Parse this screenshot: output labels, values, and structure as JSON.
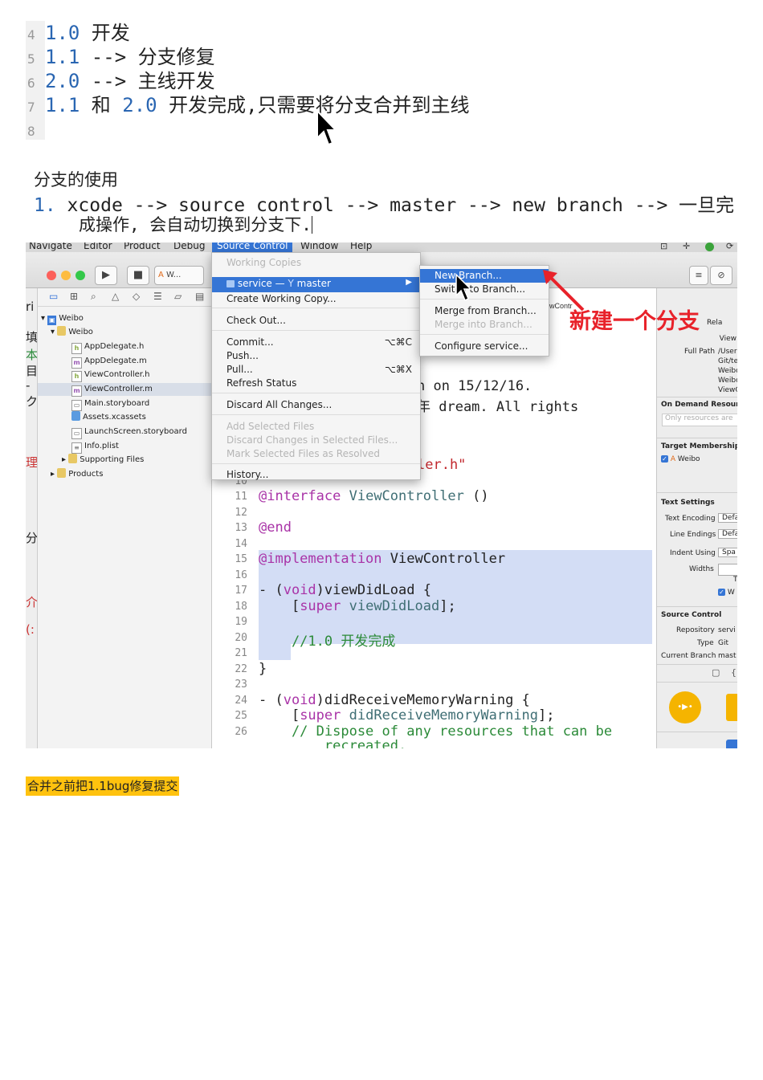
{
  "block1": {
    "lines": [
      {
        "ln": "4",
        "num": "1.0",
        "text": " 开发"
      },
      {
        "ln": "5",
        "num": "1.1",
        "text": " --> 分支修复"
      },
      {
        "ln": "6",
        "num": "2.0",
        "text": " --> 主线开发"
      },
      {
        "ln": "7",
        "num": "1.1",
        "text": " 和 ",
        "num2": "2.0",
        "text2": " 开发完成,只需要将分支合并到主线"
      },
      {
        "ln": "8",
        "num": "",
        "text": ""
      }
    ]
  },
  "block2": {
    "title": "分支的使用",
    "step_num": "1.",
    "step_text": " xcode --> source control --> master --> new branch --> 一旦完",
    "step_cont": "成操作, 会自动切换到分支下."
  },
  "screenshot": {
    "menubar": [
      "Navigate",
      "Editor",
      "Product",
      "Debug",
      "Source Control",
      "Window",
      "Help"
    ],
    "toolbar": {
      "scheme": "W..."
    },
    "left_strip": [
      "ri",
      "填",
      "本",
      "目",
      "-",
      "ク",
      "理",
      "分",
      "介",
      "(:"
    ],
    "navigator": {
      "items": [
        {
          "label": "Weibo",
          "indent": 0,
          "icon": "project"
        },
        {
          "label": "Weibo",
          "indent": 1,
          "icon": "folder"
        },
        {
          "label": "AppDelegate.h",
          "indent": 2,
          "icon": "h"
        },
        {
          "label": "AppDelegate.m",
          "indent": 2,
          "icon": "m"
        },
        {
          "label": "ViewController.h",
          "indent": 2,
          "icon": "h"
        },
        {
          "label": "ViewController.m",
          "indent": 2,
          "icon": "m"
        },
        {
          "label": "Main.storyboard",
          "indent": 2,
          "icon": "sb"
        },
        {
          "label": "Assets.xcassets",
          "indent": 2,
          "icon": "folder"
        },
        {
          "label": "LaunchScreen.storyboard",
          "indent": 2,
          "icon": "sb"
        },
        {
          "label": "Info.plist",
          "indent": 2,
          "icon": "plist"
        },
        {
          "label": "Supporting Files",
          "indent": 1,
          "icon": "folder"
        },
        {
          "label": "Products",
          "indent": 0,
          "icon": "folder"
        }
      ],
      "selected_index": 5
    },
    "editor": {
      "header_fragment": "wContr",
      "fragments": [
        {
          "text": "n on 15/12/16."
        },
        {
          "text": "年 dream. All rights"
        },
        {
          "text": "ler.h\""
        }
      ],
      "lines": [
        {
          "n": "10",
          "code": ""
        },
        {
          "n": "11",
          "code": "@interface ViewController ()"
        },
        {
          "n": "12",
          "code": ""
        },
        {
          "n": "13",
          "code": "@end"
        },
        {
          "n": "14",
          "code": ""
        },
        {
          "n": "15",
          "code": "@implementation ViewController"
        },
        {
          "n": "16",
          "code": ""
        },
        {
          "n": "17",
          "code": "- (void)viewDidLoad {"
        },
        {
          "n": "18",
          "code": "    [super viewDidLoad];"
        },
        {
          "n": "19",
          "code": ""
        },
        {
          "n": "20",
          "code": "    //1.0 开发完成"
        },
        {
          "n": "21",
          "code": ""
        },
        {
          "n": "22",
          "code": "}"
        },
        {
          "n": "23",
          "code": ""
        },
        {
          "n": "24",
          "code": "- (void)didReceiveMemoryWarning {"
        },
        {
          "n": "25",
          "code": "    [super didReceiveMemoryWarning];"
        },
        {
          "n": "26",
          "code": "    // Dispose of any resources that can be"
        },
        {
          "n": "",
          "code": "        recreated."
        }
      ]
    },
    "source_control_menu": {
      "working_copies": "Working Copies",
      "service": "service — ",
      "branch": "master",
      "create_working_copy": "Create Working Copy...",
      "check_out": "Check Out...",
      "commit": "Commit...",
      "commit_sc": "⌥⌘C",
      "push": "Push...",
      "pull": "Pull...",
      "pull_sc": "⌥⌘X",
      "refresh": "Refresh Status",
      "discard_all": "Discard All Changes...",
      "add_selected": "Add Selected Files",
      "discard_selected": "Discard Changes in Selected Files...",
      "mark_resolved": "Mark Selected Files as Resolved",
      "history": "History..."
    },
    "branch_submenu": {
      "new_branch": "New Branch...",
      "switch_branch": "Switch to Branch...",
      "merge_from": "Merge from Branch...",
      "merge_into": "Merge into Branch...",
      "configure": "Configure service..."
    },
    "annotation": "新建一个分支",
    "inspector": {
      "rela": "Rela",
      "view": "View",
      "full_path_label": "Full Path",
      "full_path_lines": [
        "/User",
        "Git/te",
        "Weibo",
        "Weibo",
        "ViewC"
      ],
      "on_demand": "On Demand Resource",
      "only_resources": "Only resources are",
      "target_membership": "Target Membership",
      "target_weibo": "Weibo",
      "text_settings": "Text Settings",
      "text_encoding_label": "Text Encoding",
      "text_encoding_val": "Defa",
      "line_endings_label": "Line Endings",
      "line_endings_val": "Defa",
      "indent_using_label": "Indent Using",
      "indent_using_val": "Spa",
      "widths_label": "Widths",
      "widths_t": "T",
      "wrap": "W",
      "source_control": "Source Control",
      "repository_label": "Repository",
      "repository_val": "servi",
      "type_label": "Type",
      "type_val": "Git",
      "current_branch_label": "Current Branch",
      "current_branch_val": "mast"
    }
  },
  "highlight_note": "合并之前把1.1bug修复提交",
  "colors": {
    "number_blue": "#2a66b2",
    "menu_select": "#3575d5",
    "annotation_red": "#e8222a",
    "highlight": "#ffc20e"
  }
}
